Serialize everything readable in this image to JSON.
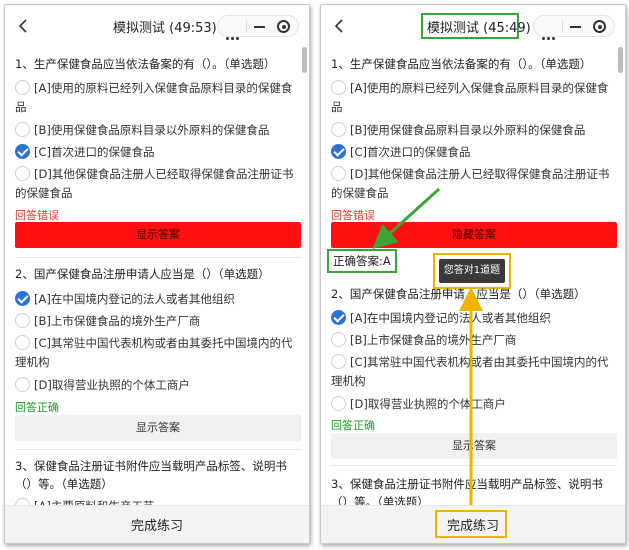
{
  "left": {
    "title": "模拟测试 (49:53)",
    "q1": {
      "text": "1、生产保健食品应当依法备案的有（）。（单选题）",
      "options": [
        "[A]使用的原料已经列入保健食品原料目录的保健食品",
        "[B]使用保健食品原料目录以外原料的保健食品",
        "[C]首次进口的保健食品",
        "[D]其他保健食品注册人已经取得保健食品注册证书的保健食品"
      ],
      "checked": 2,
      "status": "回答错误",
      "show_answer": "显示答案"
    },
    "q2": {
      "text": "2、国产保健食品注册申请人应当是（）（单选题）",
      "options": [
        "[A]在中国境内登记的法人或者其他组织",
        "[B]上市保健食品的境外生产厂商",
        "[C]其常驻中国代表机构或者由其委托中国境内的代理机构",
        "[D]取得营业执照的个体工商户"
      ],
      "checked": 0,
      "status": "回答正确",
      "show_answer": "显示答案"
    },
    "q3": {
      "text": "3、保健食品注册证书附件应当载明产品标签、说明书（）等。（单选题）",
      "option_partial": "[A]主要原料和生产工艺"
    },
    "finish": "完成练习"
  },
  "right": {
    "title": "模拟测试 (45:49)",
    "q1": {
      "text": "1、生产保健食品应当依法备案的有（）。（单选题）",
      "options": [
        "[A]使用的原料已经列入保健食品原料目录的保健食品",
        "[B]使用保健食品原料目录以外原料的保健食品",
        "[C]首次进口的保健食品",
        "[D]其他保健食品注册人已经取得保健食品注册证书的保健食品"
      ],
      "checked": 2,
      "status": "回答错误",
      "show_answer": "隐藏答案",
      "correct_answer": "正确答案:A"
    },
    "toast": "您答对1道题",
    "q2": {
      "text": "2、国产保健食品注册申请人应当是（）（单选题）",
      "options": [
        "[A]在中国境内登记的法人或者其他组织",
        "[B]上市保健食品的境外生产厂商",
        "[C]其常驻中国代表机构或者由其委托中国境内的代理机构",
        "[D]取得营业执照的个体工商户"
      ],
      "checked": 0,
      "status": "回答正确",
      "show_answer": "显示答案"
    },
    "q3": {
      "text": "3、保健食品注册证书附件应当载明产品标签、说明书（）等。（单选题）"
    },
    "finish": "完成练习"
  },
  "colors": {
    "highlight_green": "#3aa63a",
    "highlight_yellow": "#f0b400",
    "red_button": "#ff0f0f",
    "radio_checked": "#2b72d6"
  }
}
